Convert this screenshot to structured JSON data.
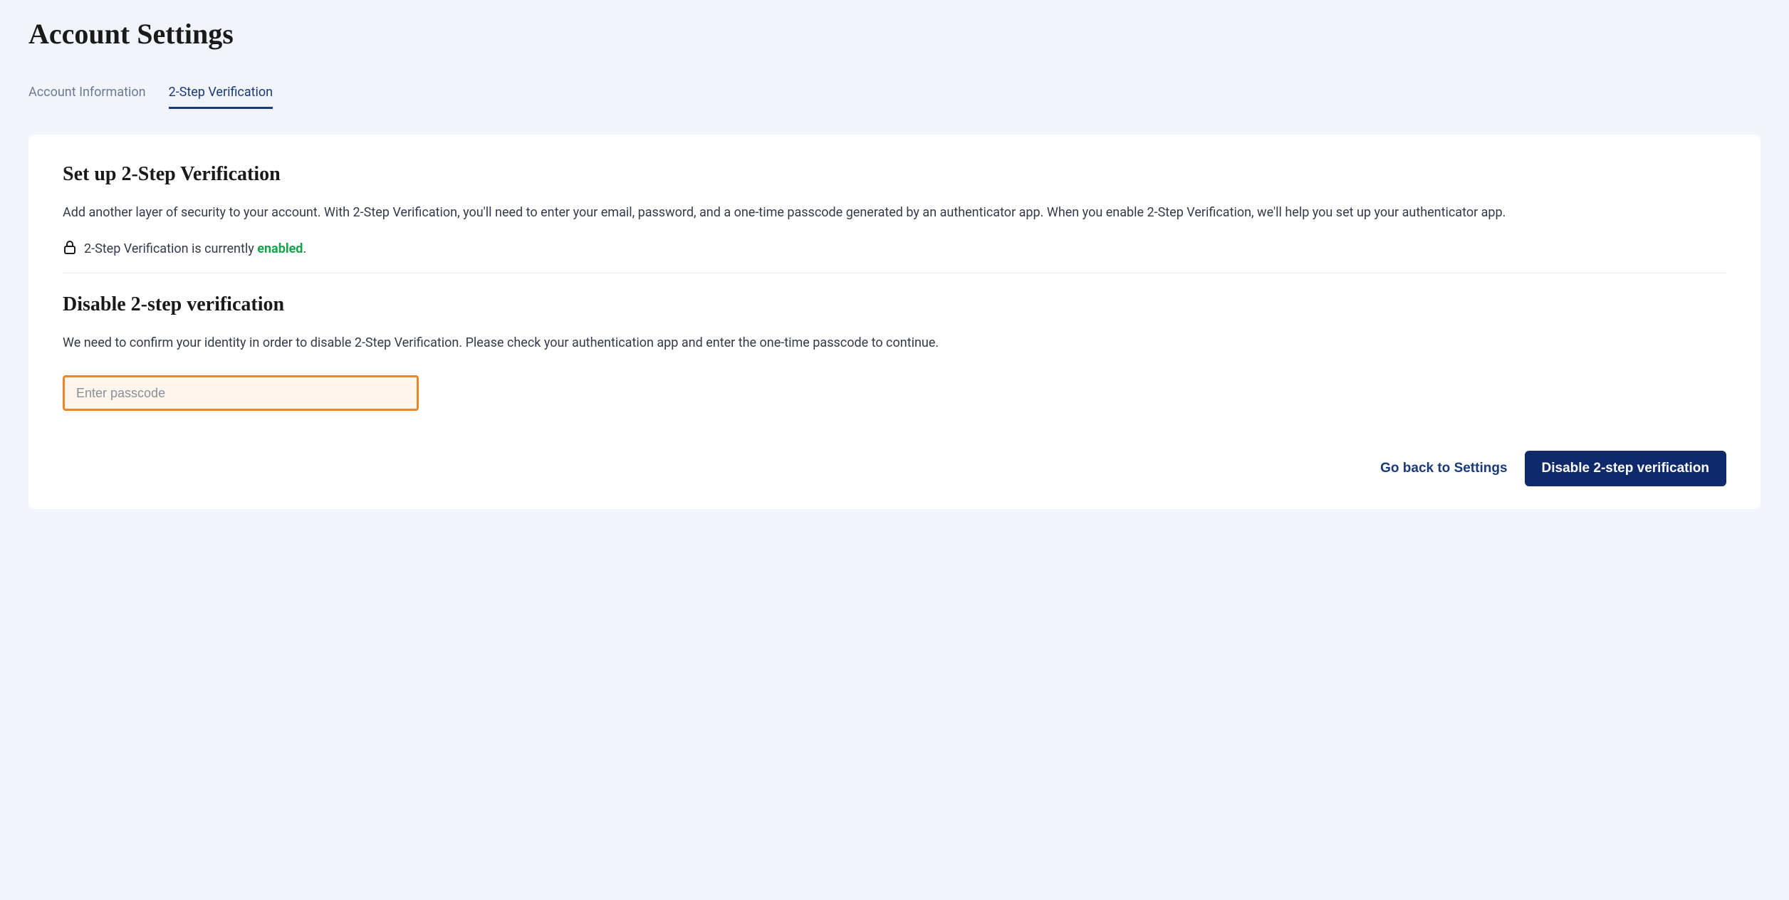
{
  "page": {
    "title": "Account Settings"
  },
  "tabs": {
    "account_info": "Account Information",
    "two_step": "2-Step Verification"
  },
  "setup": {
    "title": "Set up 2-Step Verification",
    "description": "Add another layer of security to your account. With 2-Step Verification, you'll need to enter your email, password, and a one-time passcode generated by an authenticator app. When you enable 2-Step Verification, we'll help you set up your authenticator app.",
    "status_prefix": "2-Step Verification is currently ",
    "status_value": "enabled",
    "status_suffix": "."
  },
  "disable": {
    "title": "Disable 2-step verification",
    "description": "We need to confirm your identity in order to disable 2-Step Verification. Please check your authentication app and enter the one-time passcode to continue.",
    "placeholder": "Enter passcode"
  },
  "actions": {
    "back": "Go back to Settings",
    "disable": "Disable 2-step verification"
  }
}
